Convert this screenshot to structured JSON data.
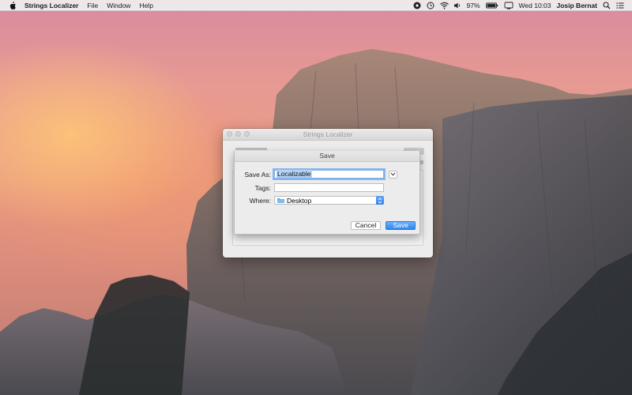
{
  "menubar": {
    "app_name": "Strings Localizer",
    "menus": [
      "File",
      "Window",
      "Help"
    ],
    "status": {
      "battery": "97%",
      "clock": "Wed 10:03",
      "user": "Josip Bernat"
    }
  },
  "window": {
    "title": "Strings Localizer"
  },
  "save_sheet": {
    "title": "Save",
    "save_as_label": "Save As:",
    "save_as_value": "Localizable",
    "tags_label": "Tags:",
    "tags_value": "",
    "where_label": "Where:",
    "where_value": "Desktop",
    "cancel_label": "Cancel",
    "save_label": "Save"
  },
  "colors": {
    "accent": "#2f86f3",
    "selection": "#b5d3f6"
  }
}
